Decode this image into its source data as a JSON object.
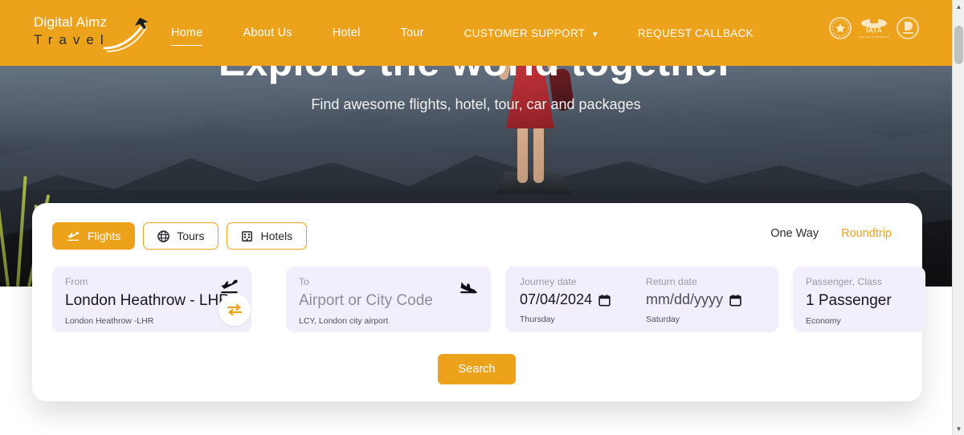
{
  "brand": {
    "line1": "Digital Aimz",
    "line2": "Travel",
    "accent": "#eda21b"
  },
  "nav": {
    "items": [
      {
        "label": "Home",
        "active": true,
        "caret": false,
        "caps": false
      },
      {
        "label": "About Us",
        "active": false,
        "caret": false,
        "caps": false
      },
      {
        "label": "Hotel",
        "active": false,
        "caret": false,
        "caps": false
      },
      {
        "label": "Tour",
        "active": false,
        "caret": false,
        "caps": false
      },
      {
        "label": "CUSTOMER SUPPORT",
        "active": false,
        "caret": true,
        "caps": true
      },
      {
        "label": "REQUEST CALLBACK",
        "active": false,
        "caret": false,
        "caps": true
      }
    ],
    "caret_glyph": "▾"
  },
  "badges": [
    {
      "name": "accreditation-seal-badge",
      "text": ""
    },
    {
      "name": "iata-badge",
      "text": "IATA"
    },
    {
      "name": "travel-association-badge",
      "text": ""
    }
  ],
  "hero": {
    "title": "Explore the world together",
    "subtitle": "Find awesome flights, hotel, tour, car and packages"
  },
  "search": {
    "tabs": [
      {
        "label": "Flights",
        "icon": "plane-takeoff-icon",
        "active": true
      },
      {
        "label": "Tours",
        "icon": "globe-icon",
        "active": false
      },
      {
        "label": "Hotels",
        "icon": "building-icon",
        "active": false
      }
    ],
    "trip_types": [
      {
        "label": "One Way",
        "selected": false
      },
      {
        "label": "Roundtrip",
        "selected": true
      }
    ],
    "from": {
      "label": "From",
      "value": "London Heathrow - LHR",
      "hint": "London Heathrow -LHR",
      "icon": "plane-takeoff-icon"
    },
    "to": {
      "label": "To",
      "value": "",
      "placeholder": "Airport or City Code",
      "hint": "LCY, London city airport",
      "icon": "plane-landing-icon"
    },
    "swap": {
      "icon": "swap-arrows-icon"
    },
    "journey_date": {
      "label": "Journey date",
      "value": "07/04/2024",
      "day": "Thursday",
      "icon": "calendar-icon"
    },
    "return_date": {
      "label": "Return date",
      "value": "",
      "placeholder": "mm/dd/yyyy",
      "day": "Saturday",
      "icon": "calendar-icon"
    },
    "passenger": {
      "label": "Passenger, Class",
      "value": "1 Passenger",
      "hint": "Economy"
    },
    "submit_label": "Search"
  }
}
